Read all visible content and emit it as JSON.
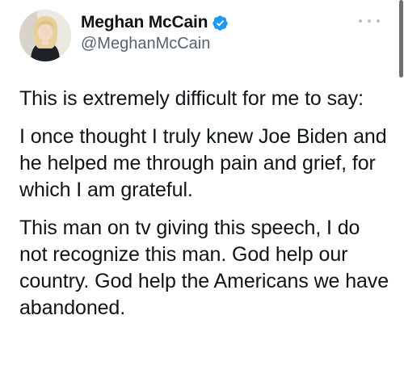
{
  "tweet": {
    "author": {
      "display_name": "Meghan McCain",
      "handle": "@MeghanMcCain",
      "verified": true,
      "avatar_icon": "profile-photo"
    },
    "more_icon": "more-options-icon",
    "paragraphs": [
      "This is extremely difficult for me to say:",
      "I once thought I truly knew Joe Biden and he helped me through pain and grief, for which I am grateful.",
      "This man on tv giving this speech, I do not recognize this man. God help our country. God help the Americans we have abandoned."
    ]
  },
  "colors": {
    "text": "#0f1419",
    "secondary_text": "#536471",
    "verified_blue": "#1d9bf0",
    "background": "#ffffff"
  }
}
